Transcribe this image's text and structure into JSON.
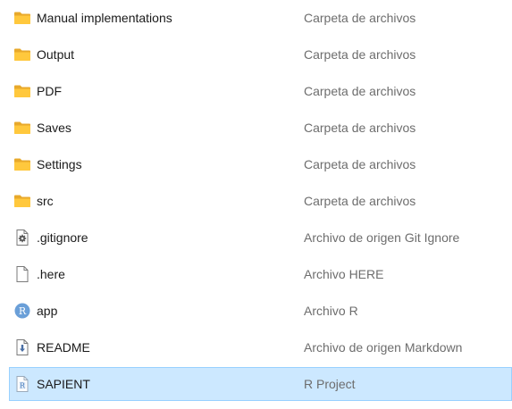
{
  "files": [
    {
      "name": "Manual implementations",
      "type": "Carpeta de archivos",
      "icon": "folder-icon"
    },
    {
      "name": "Output",
      "type": "Carpeta de archivos",
      "icon": "folder-icon"
    },
    {
      "name": "PDF",
      "type": "Carpeta de archivos",
      "icon": "folder-icon"
    },
    {
      "name": "Saves",
      "type": "Carpeta de archivos",
      "icon": "folder-icon"
    },
    {
      "name": "Settings",
      "type": "Carpeta de archivos",
      "icon": "folder-icon"
    },
    {
      "name": "src",
      "type": "Carpeta de archivos",
      "icon": "folder-icon"
    },
    {
      "name": ".gitignore",
      "type": "Archivo de origen Git Ignore",
      "icon": "settings-file-icon"
    },
    {
      "name": ".here",
      "type": "Archivo HERE",
      "icon": "blank-file-icon"
    },
    {
      "name": "app",
      "type": "Archivo R",
      "icon": "r-file-icon"
    },
    {
      "name": "README",
      "type": "Archivo de origen Markdown",
      "icon": "markdown-file-icon"
    },
    {
      "name": "SAPIENT",
      "type": "R Project",
      "icon": "r-project-icon",
      "selected": true
    }
  ],
  "colors": {
    "selection_bg": "#cce8ff",
    "selection_border": "#99d1ff",
    "folder": "#ffc83d",
    "r_blue": "#6a9fd8",
    "type_text": "#6d6d6d"
  }
}
